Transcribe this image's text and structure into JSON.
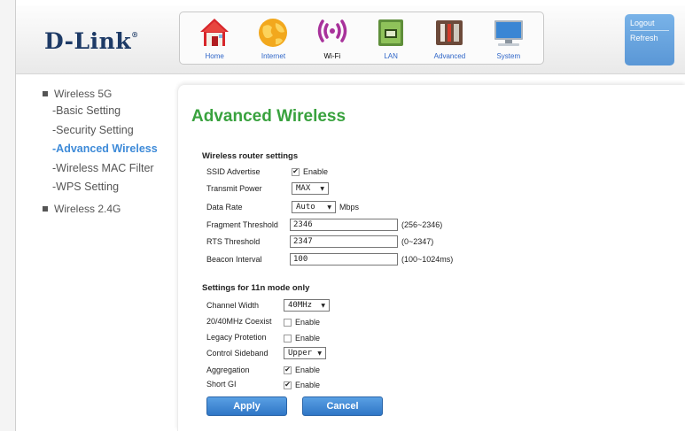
{
  "brand": {
    "logo_text": "D-Link",
    "logo_mark": "®"
  },
  "nav": {
    "items": [
      {
        "label": "Home",
        "icon": "home-icon"
      },
      {
        "label": "Internet",
        "icon": "globe-icon"
      },
      {
        "label": "Wi-Fi",
        "icon": "wifi-icon"
      },
      {
        "label": "LAN",
        "icon": "lan-icon"
      },
      {
        "label": "Advanced",
        "icon": "tools-icon"
      },
      {
        "label": "System",
        "icon": "monitor-icon"
      }
    ],
    "active": "Wi-Fi"
  },
  "account": {
    "logout": "Logout",
    "refresh": "Refresh"
  },
  "sidebar": {
    "group_5g": "Wireless 5G",
    "items": [
      "-Basic Setting",
      "-Security Setting",
      "-Advanced Wireless",
      "-Wireless MAC Filter",
      "-WPS Setting"
    ],
    "active_item": "-Advanced Wireless",
    "group_24g": "Wireless 2.4G"
  },
  "page": {
    "title": "Advanced Wireless"
  },
  "router_settings": {
    "title": "Wireless router settings",
    "ssid_advertise": {
      "label": "SSID Advertise",
      "checked": true,
      "text": "Enable"
    },
    "transmit_power": {
      "label": "Transmit Power",
      "value": "MAX"
    },
    "data_rate": {
      "label": "Data Rate",
      "value": "Auto",
      "unit": "Mbps"
    },
    "fragment_threshold": {
      "label": "Fragment Threshold",
      "value": "2346",
      "range": "(256~2346)"
    },
    "rts_threshold": {
      "label": "RTS Threshold",
      "value": "2347",
      "range": "(0~2347)"
    },
    "beacon_interval": {
      "label": "Beacon Interval",
      "value": "100",
      "range": "(100~1024ms)"
    }
  },
  "n_settings": {
    "title": "Settings for 11n mode only",
    "channel_width": {
      "label": "Channel Width",
      "value": "40MHz"
    },
    "coexist": {
      "label": "20/40MHz Coexist",
      "checked": false,
      "text": "Enable"
    },
    "legacy_protection": {
      "label": "Legacy Protetion",
      "checked": false,
      "text": "Enable"
    },
    "control_sideband": {
      "label": "Control Sideband",
      "value": "Upper"
    },
    "aggregation": {
      "label": "Aggregation",
      "checked": true,
      "text": "Enable"
    },
    "short_gi": {
      "label": "Short GI",
      "checked": true,
      "text": "Enable"
    }
  },
  "actions": {
    "apply": "Apply",
    "cancel": "Cancel"
  },
  "colors": {
    "title_green": "#39a23e",
    "nav_blue": "#2f66c8",
    "button_blue": "#3b84d2",
    "active_link": "#3d8ad8"
  }
}
